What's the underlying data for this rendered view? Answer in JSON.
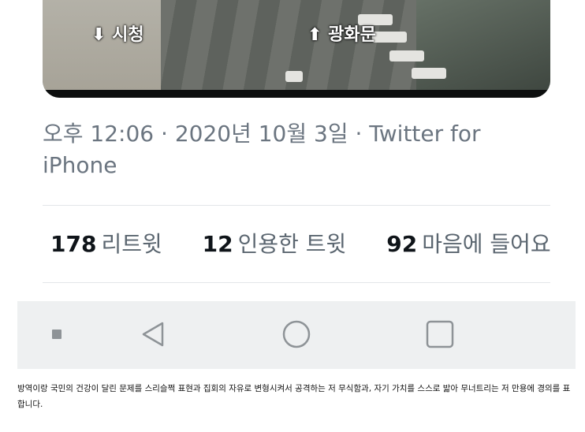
{
  "photo": {
    "left_label": "시청",
    "right_label": "광화문"
  },
  "tweet": {
    "time": "오후 12:06 · 2020년 10월 3일 · Twitter for",
    "source_line2": "iPhone",
    "retweets": {
      "count": "178",
      "label": "리트윗"
    },
    "quotes": {
      "count": "12",
      "label": "인용한 트윗"
    },
    "likes": {
      "count": "92",
      "label": "마음에 들어요"
    }
  },
  "caption": "방역이랑 국민의 건강이 달린 문제를 스리슬쩍 표현과 집회의 자유로 변형시켜서 공격하는 저 무식함과, 자기 가치를 스스로 밟아 무너트리는 저 만용에 경의를 표합니다.",
  "colors": {
    "nav_bar": "#eef0f1",
    "meta_text": "#6b7580",
    "stat_text": "#0f1419"
  }
}
